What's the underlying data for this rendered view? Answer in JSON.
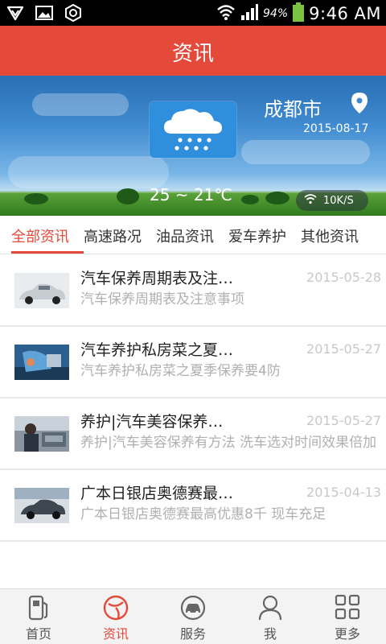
{
  "status_bar": {
    "battery_percent": "94%",
    "time": "9:46 AM",
    "icons": [
      "shield-v-icon",
      "image-icon",
      "hexagon-icon",
      "wifi-icon",
      "signal-icon",
      "battery-icon"
    ]
  },
  "header": {
    "title": "资讯"
  },
  "weather": {
    "city": "成都市",
    "date": "2015-08-17",
    "temperature": "25 ~ 21℃",
    "network_speed": "10K/S",
    "condition_icon": "rain-cloud-icon"
  },
  "tabs": [
    {
      "label": "全部资讯",
      "active": true
    },
    {
      "label": "高速路况",
      "active": false
    },
    {
      "label": "油品资讯",
      "active": false
    },
    {
      "label": "爱车养护",
      "active": false
    },
    {
      "label": "其他资讯",
      "active": false
    }
  ],
  "news": [
    {
      "title": "汽车保养周期表及注…",
      "date": "2015-05-28",
      "desc": "汽车保养周期表及注意事项"
    },
    {
      "title": "汽车养护私房菜之夏…",
      "date": "2015-05-27",
      "desc": "汽车养护私房菜之夏季保养要4防"
    },
    {
      "title": "养护|汽车美容保养…",
      "date": "2015-05-27",
      "desc": "养护|汽车美容保养有方法 洗车选对时间效果倍加"
    },
    {
      "title": "广本日银店奥德赛最…",
      "date": "2015-04-13",
      "desc": "广本日银店奥德赛最高优惠8千 现车充足"
    }
  ],
  "bottom_nav": [
    {
      "label": "首页",
      "icon": "fuel-pump-icon",
      "active": false
    },
    {
      "label": "资讯",
      "icon": "news-circle-icon",
      "active": true
    },
    {
      "label": "服务",
      "icon": "car-service-icon",
      "active": false
    },
    {
      "label": "我",
      "icon": "person-icon",
      "active": false
    },
    {
      "label": "更多",
      "icon": "grid-icon",
      "active": false
    }
  ],
  "colors": {
    "accent": "#e5493a",
    "weather_box": "#2f8fdc"
  }
}
